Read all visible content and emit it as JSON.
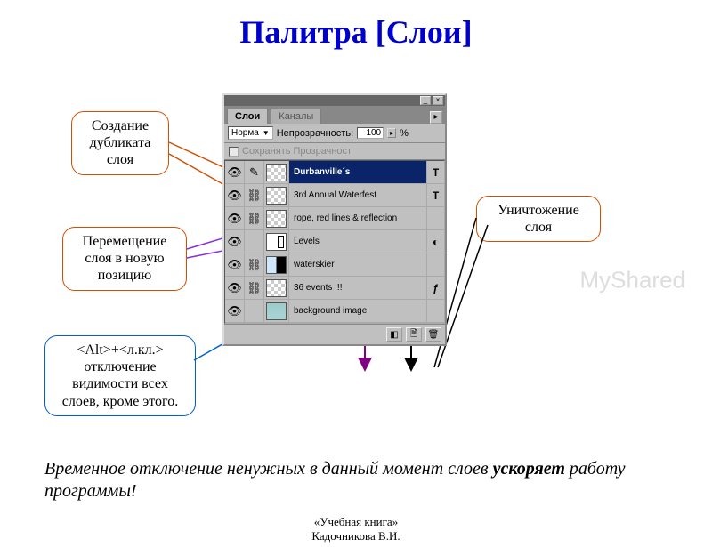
{
  "title": "Палитра [Слои]",
  "watermark": "MyShared",
  "callouts": {
    "duplicate": "Создание дубликата слоя",
    "move": "Перемещение слоя в новую позицию",
    "alt_vis_prefix": "<Alt>",
    "alt_vis_mid": "+",
    "alt_vis_suffix": "<л.кл.>",
    "alt_vis_rest": "отключение видимости всех слоев, кроме этого.",
    "delete": "Уничтожение слоя"
  },
  "panel": {
    "tabs": {
      "layers": "Слои",
      "channels": "Каналы"
    },
    "blend_label": "Норма",
    "opacity_label": "Непрозрачность:",
    "opacity_value": "100",
    "opacity_pct": "%",
    "preserve": "Сохранять Прозрачност",
    "rows": [
      {
        "name": "Durbanville´s",
        "mask": "T"
      },
      {
        "name": "3rd Annual Waterfest",
        "mask": "T"
      },
      {
        "name": "rope, red lines & reflection",
        "mask": ""
      },
      {
        "name": "Levels",
        "mask": "◐"
      },
      {
        "name": "waterskier",
        "mask": ""
      },
      {
        "name": "36 events !!!",
        "mask": "ƒ"
      },
      {
        "name": "background image",
        "mask": ""
      }
    ]
  },
  "tip": {
    "line1": "Временное отключение ненужных в данный момент слоев ",
    "line2_strong": "ускоряет",
    "line2_rest": " работу программы!"
  },
  "credit": {
    "l1": "«Учебная книга»",
    "l2": "Кадочникова В.И."
  }
}
